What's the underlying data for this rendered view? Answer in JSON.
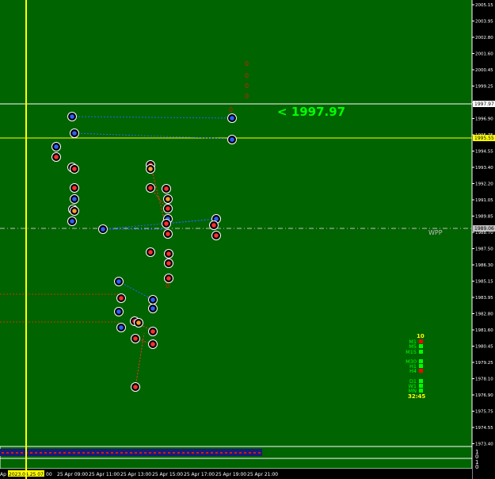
{
  "colors": {
    "background": "#006400",
    "axis_bg": "#000000",
    "grid_text": "#ffffff",
    "cursor_line": "#ffff00",
    "price_line_white": "#ffffff",
    "price_line_yellow": "#ffff00",
    "wpp_line": "#c0c0c0",
    "big_price": "#00ff00",
    "blue_marker": "#3060ff",
    "red_marker": "#ff3030",
    "orange_marker": "#ff9933",
    "tf_up": "#00ff00",
    "tf_down": "#ff0000",
    "timer": "#ffff00",
    "count": "#ffff00"
  },
  "price_axis": {
    "labels": [
      "2005.15",
      "2003.95",
      "2002.80",
      "2001.60",
      "2000.45",
      "1999.25",
      "1998.10",
      "1996.90",
      "1995.75",
      "1994.55",
      "1993.40",
      "1992.20",
      "1991.05",
      "1989.85",
      "1988.70",
      "1987.50",
      "1986.30",
      "1985.15",
      "1983.95",
      "1982.80",
      "1981.60",
      "1980.45",
      "1979.25",
      "1978.10",
      "1976.90",
      "1975.75",
      "1974.55",
      "1973.40"
    ],
    "tag_white": "1997.97",
    "tag_yellow": "1995.55",
    "tag_gray": "1989.06"
  },
  "time_axis": {
    "cursor_label": "2023.04.25 07:00",
    "left_stub": "Ap",
    "left_tail": "00",
    "labels": [
      "25 Apr 09:00",
      "25 Apr 11:00",
      "25 Apr 13:00",
      "25 Apr 15:00",
      "25 Apr 17:00",
      "25 Apr 19:00",
      "25 Apr 21:00"
    ]
  },
  "big_price_text": "<  1997.97",
  "wpp_label": "WPP",
  "red_zero_glyphs": [
    "0",
    "0",
    "0",
    "0",
    "0",
    "0"
  ],
  "timeframes": {
    "count": "10",
    "items": [
      {
        "label": "M1",
        "state": "down"
      },
      {
        "label": "M5",
        "state": "up"
      },
      {
        "label": "M15",
        "state": "up"
      },
      {
        "label": "M30",
        "state": "up"
      },
      {
        "label": "H1",
        "state": "up"
      },
      {
        "label": "H4",
        "state": "down"
      },
      {
        "label": "D1",
        "state": "up"
      },
      {
        "label": "W1",
        "state": "up"
      },
      {
        "label": "MN",
        "state": "up"
      }
    ],
    "timer": "32:45"
  },
  "subpanels": {
    "panel1_scale": [
      "1",
      "0"
    ],
    "panel2_scale": [
      "1",
      "0"
    ]
  }
}
